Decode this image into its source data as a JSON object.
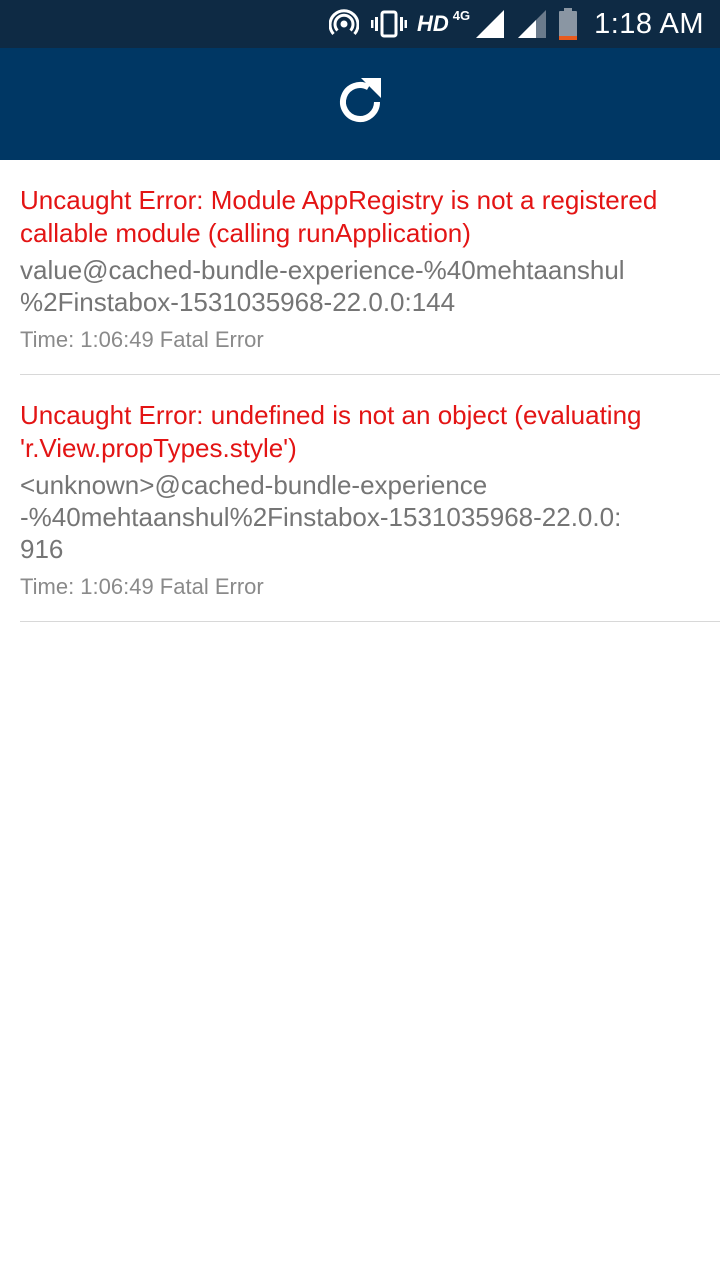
{
  "status_bar": {
    "hd_label": "HD",
    "network_type": "4G",
    "time": "1:18 AM",
    "icons": [
      "hotspot-icon",
      "vibrate-icon",
      "signal-icon",
      "signal-icon-2",
      "battery-icon"
    ]
  },
  "header": {
    "reload_icon": "reload-icon",
    "background_color": "#003764"
  },
  "errors": [
    {
      "message": "Uncaught Error: Module AppRegistry is not a registered callable module (calling runApplication)",
      "stack": "value@cached-bundle-experience-%40mehtaanshul\n%2Finstabox-1531035968-22.0.0:144",
      "meta": "Time: 1:06:49 Fatal Error"
    },
    {
      "message": "Uncaught Error: undefined is not an object (evaluating 'r.View.propTypes.style')",
      "stack": "<unknown>@cached-bundle-experience\n-%40mehtaanshul%2Finstabox-1531035968-22.0.0:\n916",
      "meta": "Time: 1:06:49 Fatal Error"
    }
  ],
  "colors": {
    "error_text": "#e31414",
    "stack_text": "#757575",
    "status_bar": "#0e2a44"
  }
}
